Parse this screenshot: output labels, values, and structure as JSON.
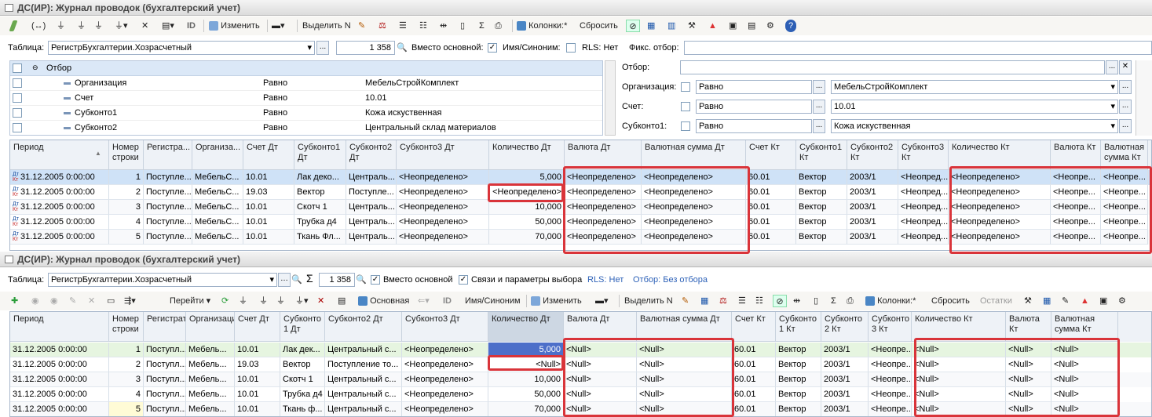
{
  "top": {
    "title": "ДС(ИР): Журнал проводок (бухгалтерский учет)",
    "toolbar": {
      "izmenit": "Изменить",
      "vydelit": "Выделить N",
      "kolonki": "Колонки:*",
      "sbrosit": "Сбросить"
    },
    "table_label": "Таблица:",
    "table_value": "РегистрБухгалтерии.Хозрасчетный",
    "count": "1 358",
    "vmesto_osnovnoy": "Вместо основной:",
    "imya_sinonim": "Имя/Синоним:",
    "rls": "RLS: Нет",
    "fiks_otbor": "Фикс. отбор:",
    "filter_tree": {
      "root": "Отбор",
      "rows": [
        {
          "name": "Организация",
          "cond": "Равно",
          "value": "МебельСтройКомплект"
        },
        {
          "name": "Счет",
          "cond": "Равно",
          "value": "10.01"
        },
        {
          "name": "Субконто1",
          "cond": "Равно",
          "value": "Кожа искуственная"
        },
        {
          "name": "Субконто2",
          "cond": "Равно",
          "value": "Центральный склад материалов"
        }
      ]
    },
    "filter_form": {
      "otbor": "Отбор:",
      "org_label": "Организация:",
      "org_cond": "Равно",
      "org_value": "МебельСтройКомплект",
      "schet_label": "Счет:",
      "schet_cond": "Равно",
      "schet_value": "10.01",
      "sub_label": "Субконто1:",
      "sub_cond": "Равно",
      "sub_value": "Кожа искуственная",
      "ellipsis": "...",
      "close": "✕"
    },
    "columns": [
      "Период",
      "Номер строки",
      "Регистра...",
      "Организа...",
      "Счет Дт",
      "Субконто1 Дт",
      "Субконто2 Дт",
      "Субконто3 Дт",
      "Количество Дт",
      "Валюта Дт",
      "Валютная сумма Дт",
      "Счет Кт",
      "Субконто1 Кт",
      "Субконто2 Кт",
      "Субконто3 Кт",
      "Количество Кт",
      "Валюта Кт",
      "Валютная сумма Кт"
    ],
    "rows": [
      [
        "31.12.2005 0:00:00",
        "1",
        "Поступле...",
        "МебельС...",
        "10.01",
        "Лак деко...",
        "Централь...",
        "<Неопределено>",
        "5,000",
        "<Неопределено>",
        "<Неопределено>",
        "60.01",
        "Вектор",
        "2003/1",
        "<Неопред...",
        "<Неопределено>",
        "<Неопре...",
        "<Неопре..."
      ],
      [
        "31.12.2005 0:00:00",
        "2",
        "Поступле...",
        "МебельС...",
        "19.03",
        "Вектор",
        "Поступле...",
        "<Неопределено>",
        "<Неопределено>",
        "<Неопределено>",
        "<Неопределено>",
        "60.01",
        "Вектор",
        "2003/1",
        "<Неопред...",
        "<Неопределено>",
        "<Неопре...",
        "<Неопре..."
      ],
      [
        "31.12.2005 0:00:00",
        "3",
        "Поступле...",
        "МебельС...",
        "10.01",
        "Скотч 1",
        "Централь...",
        "<Неопределено>",
        "10,000",
        "<Неопределено>",
        "<Неопределено>",
        "60.01",
        "Вектор",
        "2003/1",
        "<Неопред...",
        "<Неопределено>",
        "<Неопре...",
        "<Неопре..."
      ],
      [
        "31.12.2005 0:00:00",
        "4",
        "Поступле...",
        "МебельС...",
        "10.01",
        "Трубка д4",
        "Централь...",
        "<Неопределено>",
        "50,000",
        "<Неопределено>",
        "<Неопределено>",
        "60.01",
        "Вектор",
        "2003/1",
        "<Неопред...",
        "<Неопределено>",
        "<Неопре...",
        "<Неопре..."
      ],
      [
        "31.12.2005 0:00:00",
        "5",
        "Поступле...",
        "МебельС...",
        "10.01",
        "Ткань Фл...",
        "Централь...",
        "<Неопределено>",
        "70,000",
        "<Неопределено>",
        "<Неопределено>",
        "60.01",
        "Вектор",
        "2003/1",
        "<Неопред...",
        "<Неопределено>",
        "<Неопре...",
        "<Неопре..."
      ]
    ]
  },
  "bottom": {
    "title": "ДС(ИР): Журнал проводок (бухгалтерский учет)",
    "table_label": "Таблица:",
    "table_value": "РегистрБухгалтерии.Хозрасчетный",
    "count": "1 358",
    "vmesto_osnovnoy": "Вместо основной",
    "svyazi": "Связи и параметры выбора",
    "rls": "RLS: Нет",
    "otbor": "Отбор: Без отбора",
    "toolbar": {
      "pereyti": "Перейти",
      "osnovnaya": "Основная",
      "imya_sinonim": "Имя/Синоним",
      "izmenit": "Изменить",
      "vydelit": "Выделить N",
      "kolonki": "Колонки:*",
      "sbrosit": "Сбросить",
      "ostatki": "Остатки"
    },
    "columns": [
      "Период",
      "Номер строки",
      "Регистратор",
      "Организация",
      "Счет Дт",
      "Субконто 1 Дт",
      "Субконто2 Дт",
      "Субконто3 Дт",
      "Количество Дт",
      "Валюта Дт",
      "Валютная сумма Дт",
      "Счет Кт",
      "Субконто 1 Кт",
      "Субконто 2 Кт",
      "Субконто 3 Кт",
      "Количество Кт",
      "Валюта Кт",
      "Валютная сумма Кт"
    ],
    "rows": [
      [
        "31.12.2005 0:00:00",
        "1",
        "Поступл...",
        "Мебель...",
        "10.01",
        "Лак дек...",
        "Центральный с...",
        "<Неопределено>",
        "5,000",
        "<Null>",
        "<Null>",
        "60.01",
        "Вектор",
        "2003/1",
        "<Неопре...",
        "<Null>",
        "<Null>",
        "<Null>"
      ],
      [
        "31.12.2005 0:00:00",
        "2",
        "Поступл...",
        "Мебель...",
        "19.03",
        "Вектор",
        "Поступление то...",
        "<Неопределено>",
        "<Null>",
        "<Null>",
        "<Null>",
        "60.01",
        "Вектор",
        "2003/1",
        "<Неопре...",
        "<Null>",
        "<Null>",
        "<Null>"
      ],
      [
        "31.12.2005 0:00:00",
        "3",
        "Поступл...",
        "Мебель...",
        "10.01",
        "Скотч 1",
        "Центральный с...",
        "<Неопределено>",
        "10,000",
        "<Null>",
        "<Null>",
        "60.01",
        "Вектор",
        "2003/1",
        "<Неопре...",
        "<Null>",
        "<Null>",
        "<Null>"
      ],
      [
        "31.12.2005 0:00:00",
        "4",
        "Поступл...",
        "Мебель...",
        "10.01",
        "Трубка д4",
        "Центральный с...",
        "<Неопределено>",
        "50,000",
        "<Null>",
        "<Null>",
        "60.01",
        "Вектор",
        "2003/1",
        "<Неопре...",
        "<Null>",
        "<Null>",
        "<Null>"
      ],
      [
        "31.12.2005 0:00:00",
        "5",
        "Поступл...",
        "Мебель...",
        "10.01",
        "Ткань ф...",
        "Центральный с...",
        "<Неопределено>",
        "70,000",
        "<Null>",
        "<Null>",
        "60.01",
        "Вектор",
        "2003/1",
        "<Неопре...",
        "<Null>",
        "<Null>",
        "<Null>"
      ]
    ]
  },
  "colors": {
    "accent_red": "#d9343a",
    "selected_row": "#cfe2f7",
    "green_row": "#e6f5e0",
    "header_bg": "#eef2f7"
  }
}
